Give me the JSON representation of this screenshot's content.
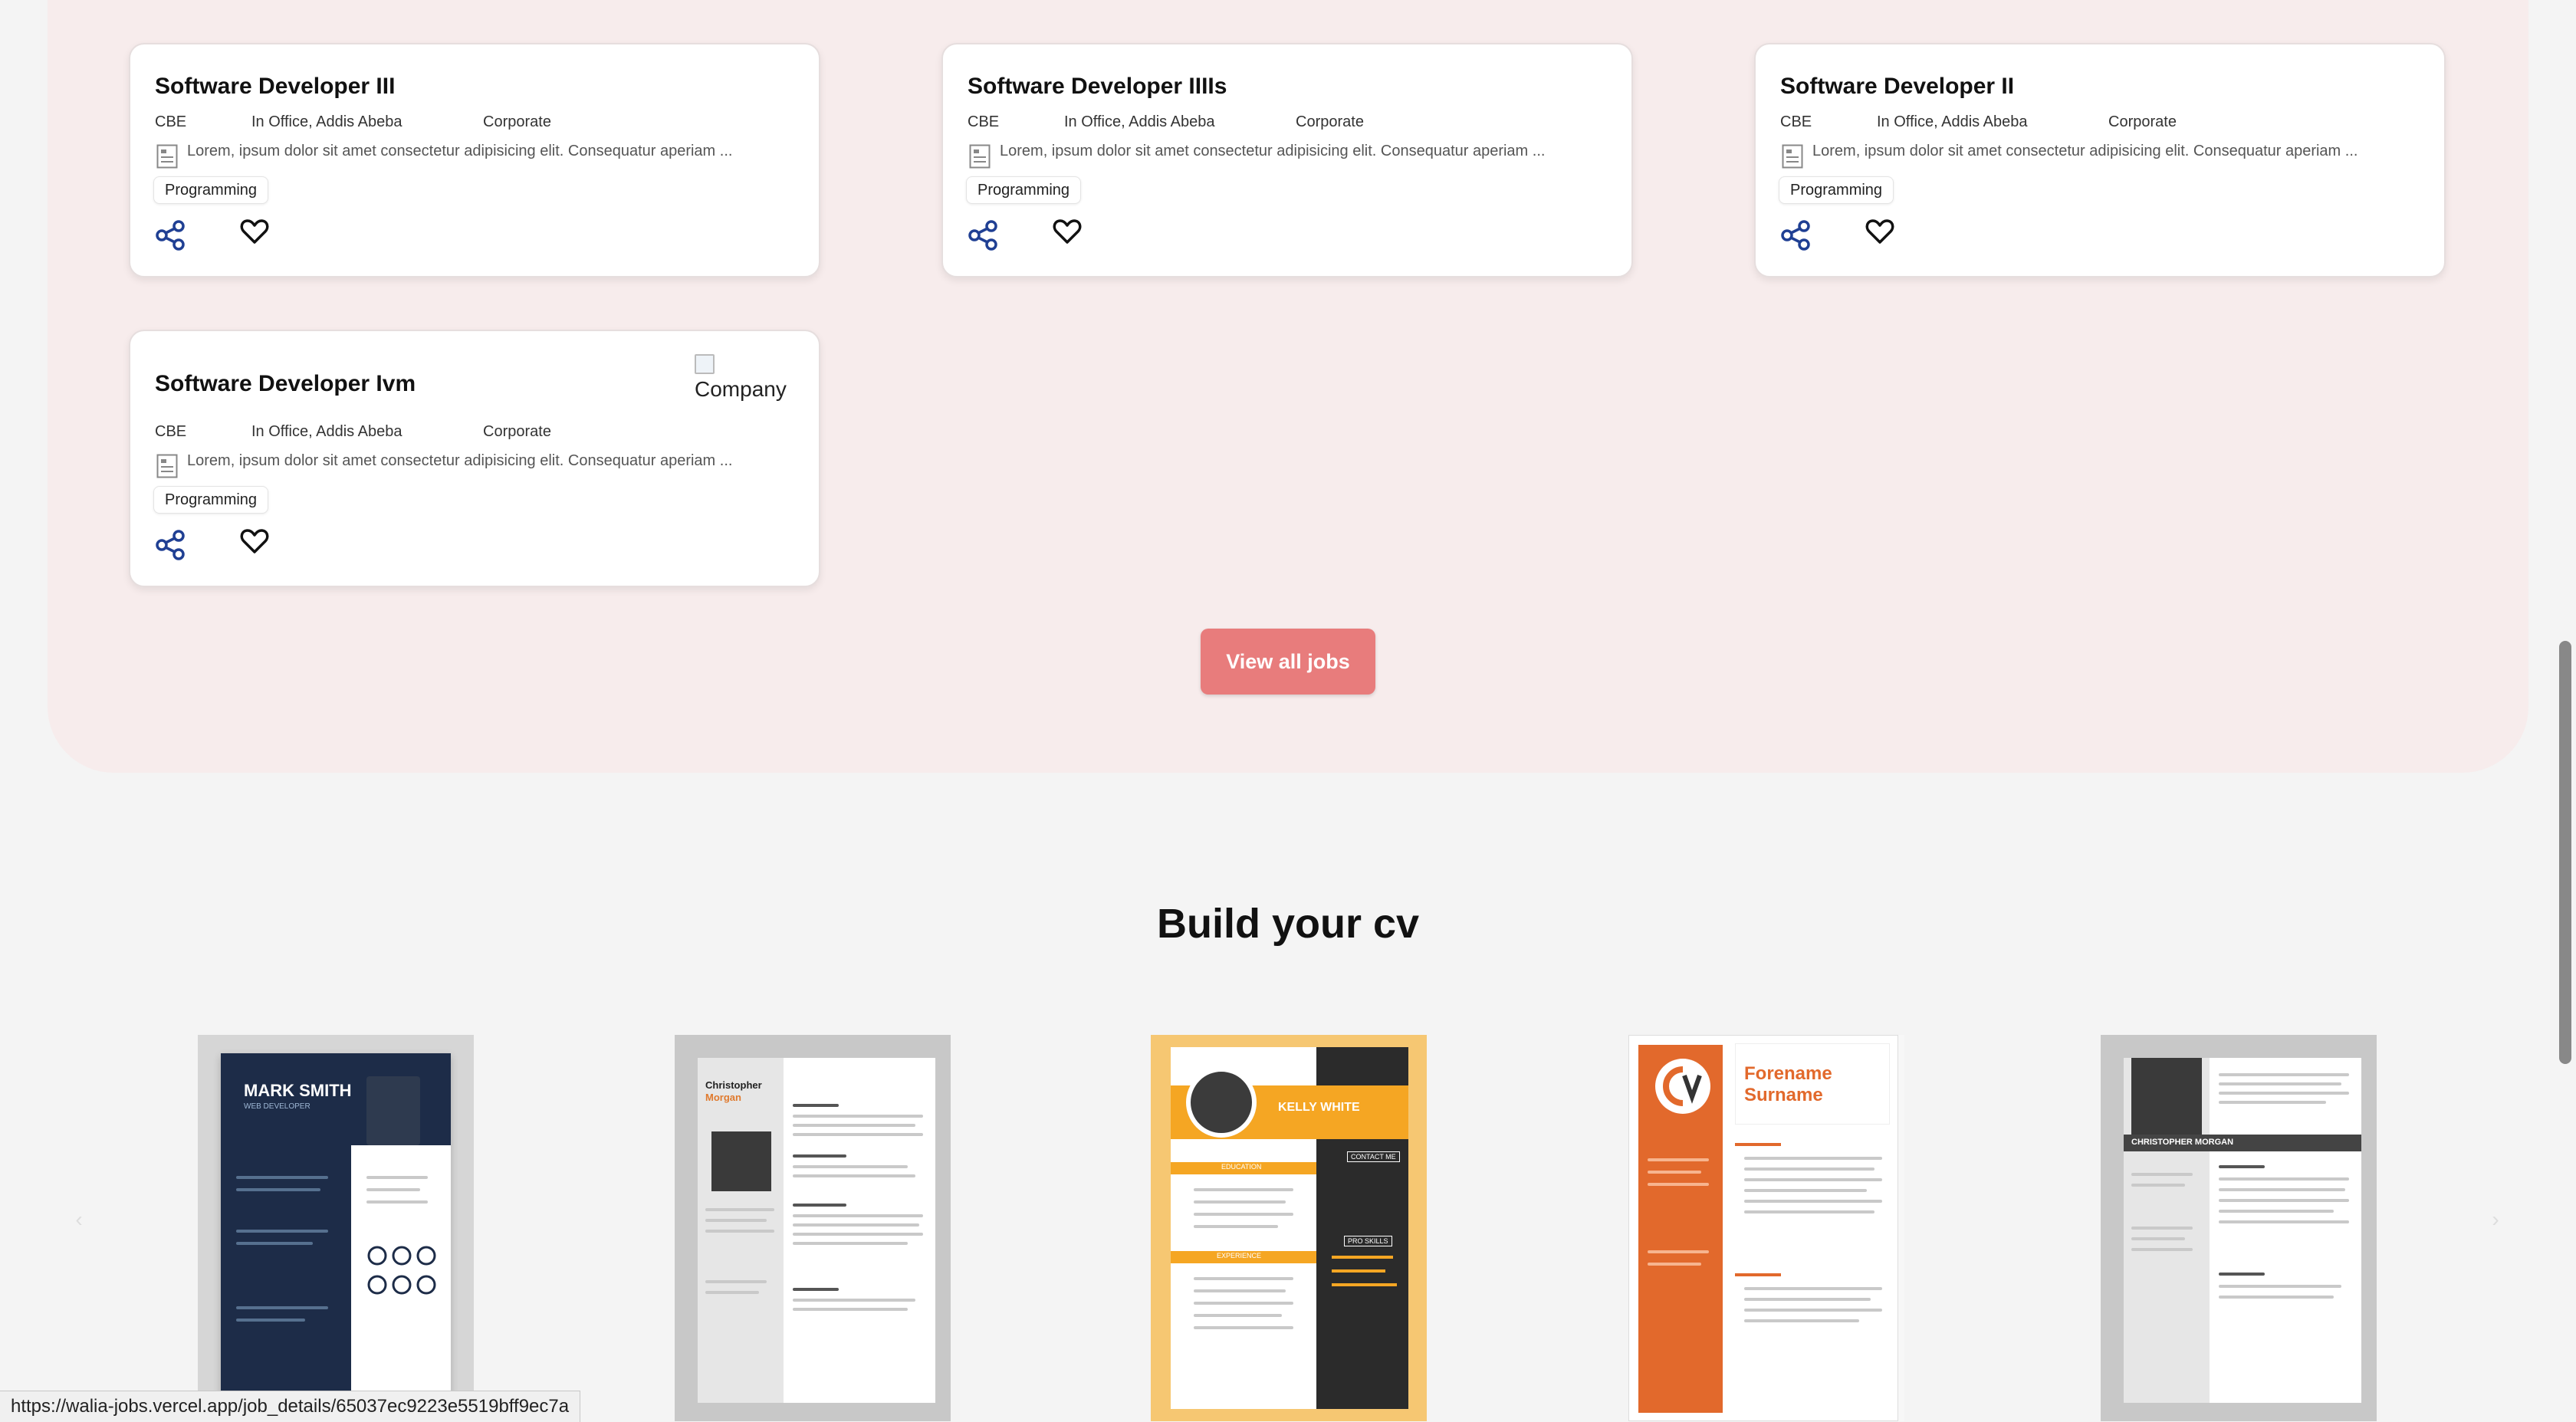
{
  "jobs": [
    {
      "title": "Software Developer III",
      "company": "CBE",
      "location": "In Office, Addis Abeba",
      "type": "Corporate",
      "description": "Lorem, ipsum dolor sit amet consectetur adipisicing elit. Consequatur aperiam ...",
      "tag": "Programming"
    },
    {
      "title": "Software Developer IIIIs",
      "company": "CBE",
      "location": "In Office, Addis Abeba",
      "type": "Corporate",
      "description": "Lorem, ipsum dolor sit amet consectetur adipisicing elit. Consequatur aperiam ...",
      "tag": "Programming"
    },
    {
      "title": "Software Developer II",
      "company": "CBE",
      "location": "In Office, Addis Abeba",
      "type": "Corporate",
      "description": "Lorem, ipsum dolor sit amet consectetur adipisicing elit. Consequatur aperiam ...",
      "tag": "Programming"
    },
    {
      "title": "Software Developer Ivm",
      "company": "CBE",
      "location": "In Office, Addis Abeba",
      "type": "Corporate",
      "description": "Lorem, ipsum dolor sit amet consectetur adipisicing elit. Consequatur aperiam ...",
      "tag": "Programming",
      "logo_alt": "Company"
    }
  ],
  "view_all_label": "View all jobs",
  "cv_section": {
    "heading": "Build your cv",
    "templates": [
      {
        "name": "MARK SMITH",
        "role": "WEB DEVELOPER"
      },
      {
        "name": "Christopher",
        "surname": "Morgan"
      },
      {
        "name": "KELLY WHITE",
        "sections": [
          "CONTACT ME",
          "EDUCATION",
          "PRO SKILLS",
          "EXPERIENCE"
        ]
      },
      {
        "name": "Forename",
        "surname": "Surname"
      },
      {
        "name": "CHRISTOPHER MORGAN"
      }
    ]
  },
  "status_url": "https://walia-jobs.vercel.app/job_details/65037ec9223e5519bff9ec7a",
  "colors": {
    "accent": "#e87c7c",
    "section_bg": "#f7ecec",
    "icon_blue": "#1f3f93"
  }
}
